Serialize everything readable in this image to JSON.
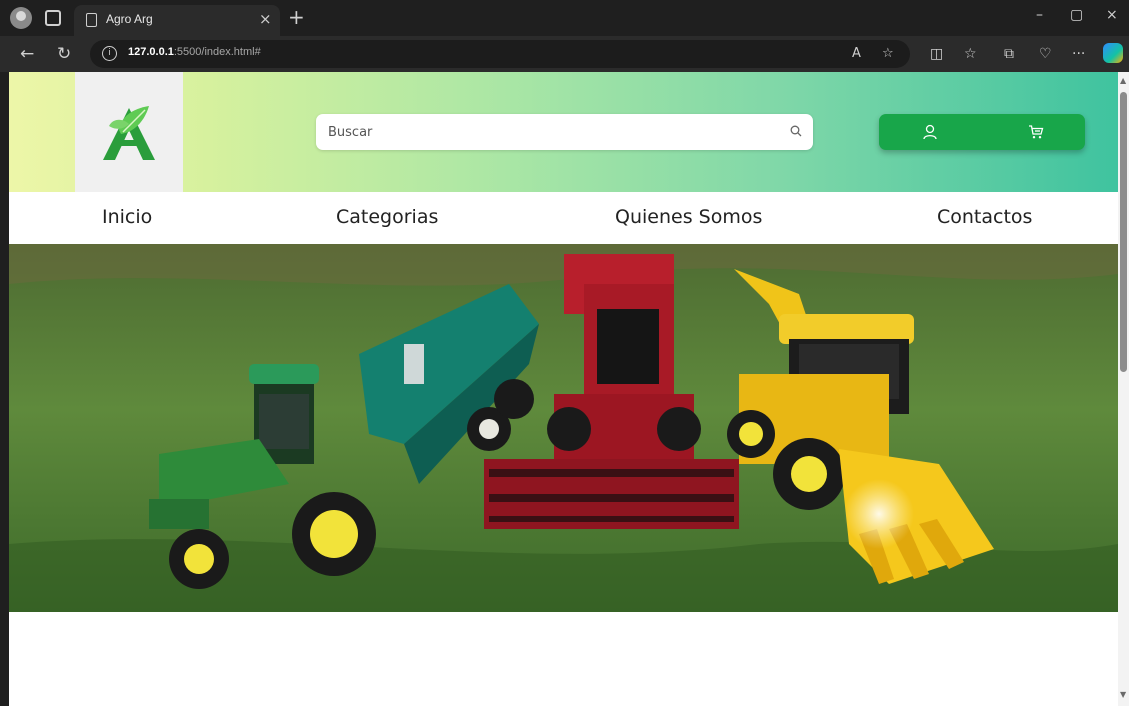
{
  "browser": {
    "tab_title": "Agro Arg",
    "tab_close": "×",
    "new_tab": "+",
    "url_host": "127.0.0.1",
    "url_rest": ":5500/index.html#",
    "window_controls": [
      "–",
      "▢",
      "×"
    ]
  },
  "header": {
    "logo_icon": "leaf-a-logo",
    "search_placeholder": "Buscar",
    "search_icon": "search-icon",
    "user_icon": "user-icon",
    "cart_icon": "cart-icon",
    "colors": {
      "gradient_start": "#edf6a8",
      "gradient_end": "#3fc39f",
      "action_green": "#18a64a",
      "logo_green": "#2a9d3b"
    }
  },
  "nav": {
    "items": [
      "Inicio",
      "Categorias",
      "Quienes Somos",
      "Contactos"
    ]
  },
  "hero": {
    "image": "farm-machinery-banner"
  }
}
